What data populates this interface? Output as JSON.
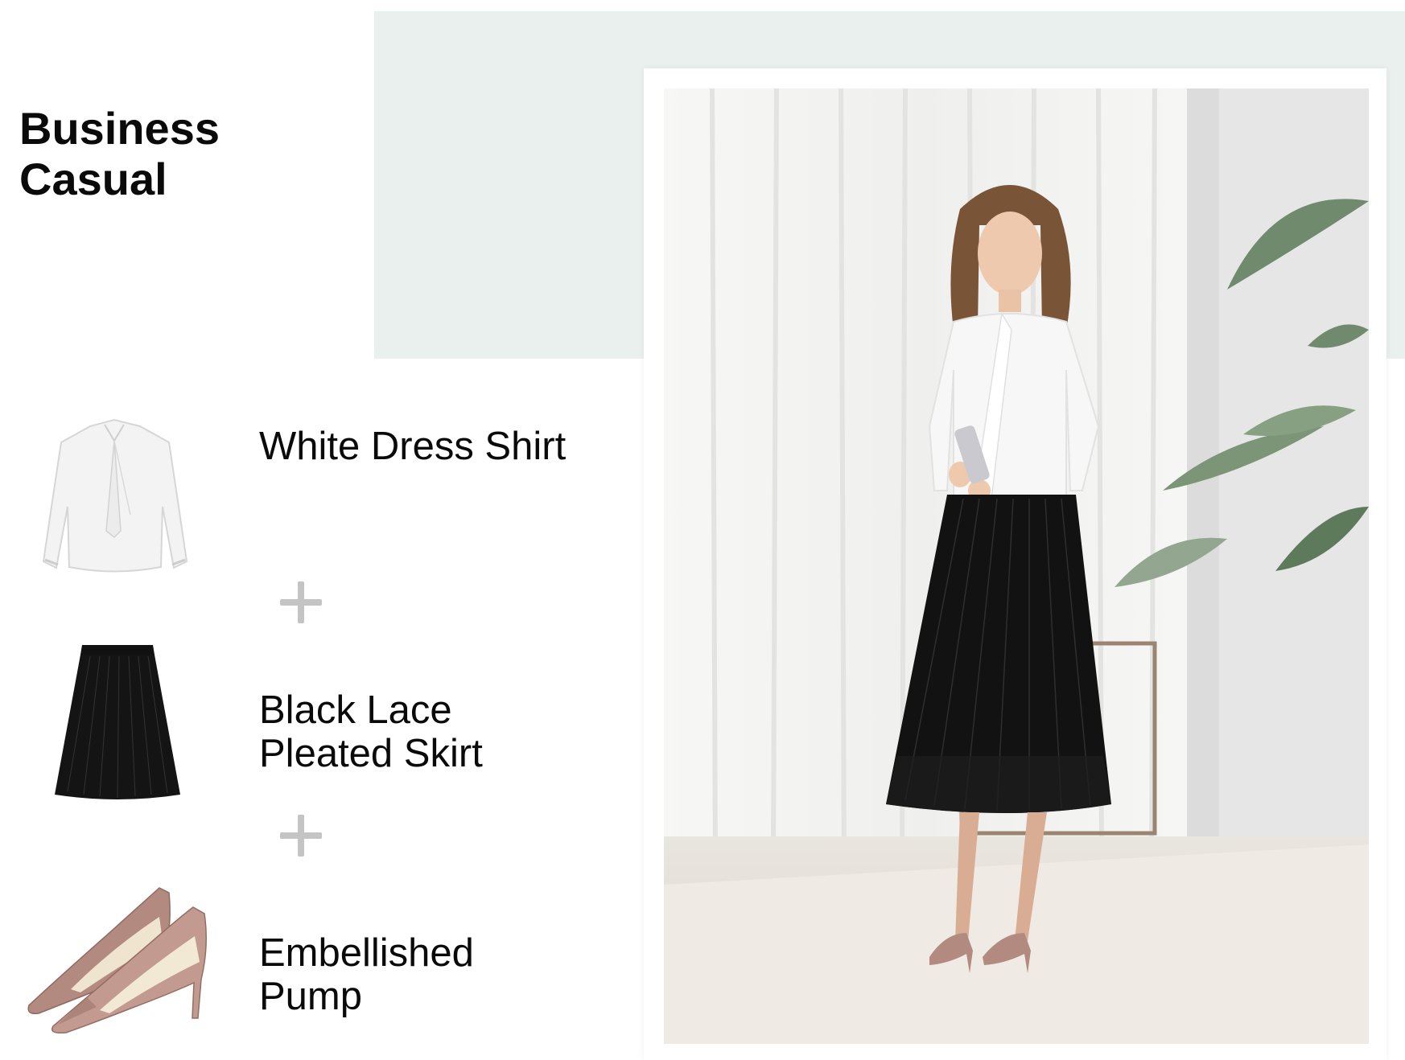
{
  "title": {
    "line1": "Business",
    "line2": "Casual"
  },
  "items": [
    {
      "name": "White Dress Shirt",
      "line1": "White Dress Shirt",
      "line2": "",
      "icon": "blouse-icon"
    },
    {
      "name": "Black Lace Pleated Skirt",
      "line1": "Black Lace",
      "line2": "Pleated Skirt",
      "icon": "skirt-icon"
    },
    {
      "name": "Embellished Pump",
      "line1": "Embellished",
      "line2": "Pump",
      "icon": "pump-shoes-icon"
    }
  ],
  "separator_icon": "plus-icon",
  "photo": {
    "subject": "model-outfit-photo"
  },
  "colors": {
    "panel_bg": "#eaf0ee",
    "plus": "#c4c4c4",
    "text": "#0a0a0a"
  }
}
